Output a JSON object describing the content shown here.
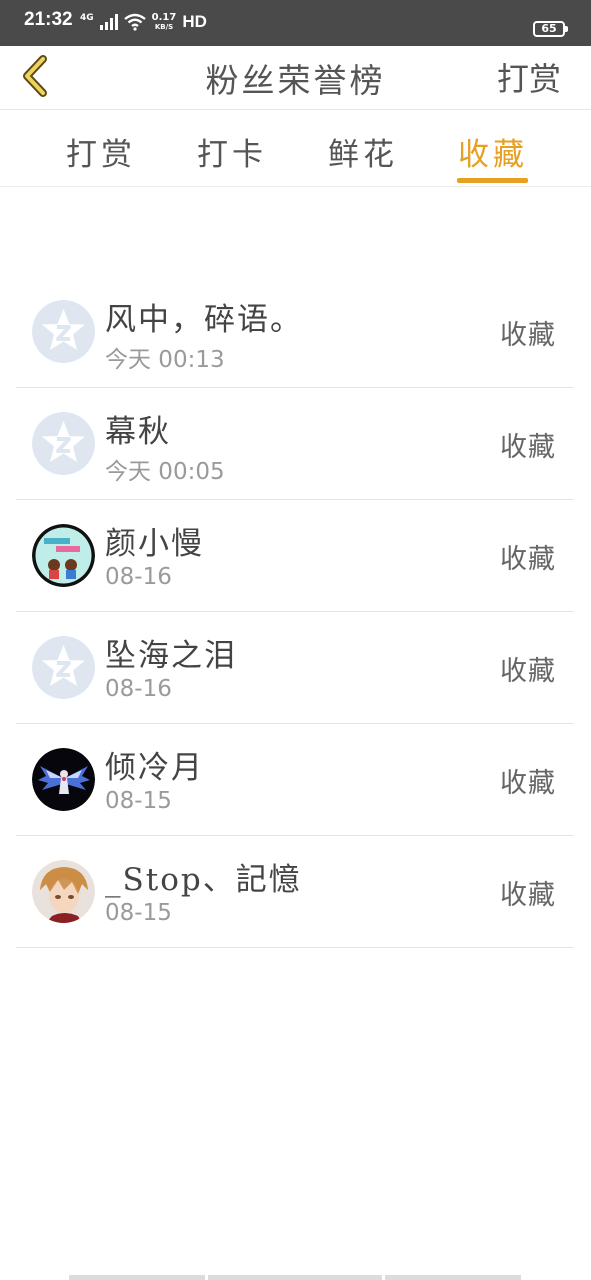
{
  "status_bar": {
    "time": "21:32",
    "network": "4G",
    "speed_value": "0.17",
    "speed_unit": "KB/S",
    "hd": "HD",
    "battery": "65"
  },
  "header": {
    "title": "粉丝荣誉榜",
    "right_action": "打赏"
  },
  "tabs": [
    {
      "label": "打赏",
      "active": false
    },
    {
      "label": "打卡",
      "active": false
    },
    {
      "label": "鲜花",
      "active": false
    },
    {
      "label": "收藏",
      "active": true
    }
  ],
  "accent_color": "#e6a023",
  "list": [
    {
      "name": "风中，碎语。",
      "time": "今天 00:13",
      "action": "收藏",
      "avatar": "default-star-icon"
    },
    {
      "name": "幕秋",
      "time": "今天 00:05",
      "action": "收藏",
      "avatar": "default-star-icon"
    },
    {
      "name": "颜小慢",
      "time": "08-16",
      "action": "收藏",
      "avatar": "cartoon-couple-avatar"
    },
    {
      "name": "坠海之泪",
      "time": "08-16",
      "action": "收藏",
      "avatar": "default-star-icon"
    },
    {
      "name": "倾冷月",
      "time": "08-15",
      "action": "收藏",
      "avatar": "angel-wings-avatar"
    },
    {
      "name": "_Stop、記憶",
      "time": "08-15",
      "action": "收藏",
      "avatar": "anime-boy-avatar"
    }
  ]
}
